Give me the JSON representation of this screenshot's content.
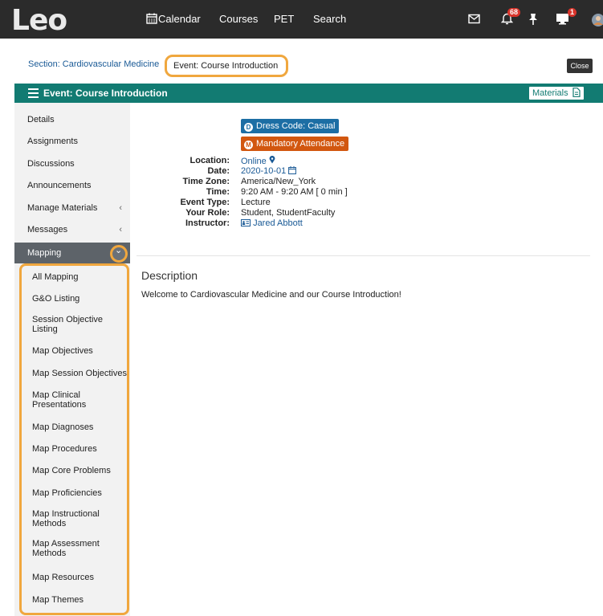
{
  "app": {
    "logo": "Leo",
    "nav": [
      "Calendar",
      "Courses",
      "PET",
      "Search"
    ],
    "notification_count": "68",
    "monitor_count": "1"
  },
  "breadcrumb": {
    "section": "Section: Cardiovascular Medicine",
    "current": "Event: Course Introduction",
    "close": "Close"
  },
  "titlebar": {
    "title": "Event: Course Introduction",
    "materials": "Materials"
  },
  "sidebar": {
    "items": [
      "Details",
      "Assignments",
      "Discussions",
      "Announcements",
      "Manage Materials",
      "Messages",
      "Mapping"
    ],
    "submenu": [
      "All Mapping",
      "G&O Listing",
      "Session Objective Listing",
      "Map Objectives",
      "Map Session Objectives",
      "Map Clinical Presentations",
      "Map Diagnoses",
      "Map Procedures",
      "Map Core Problems",
      "Map Proficiencies",
      "Map Instructional Methods",
      "Map Assessment Methods",
      "Map Resources",
      "Map Themes"
    ]
  },
  "event": {
    "tags": [
      {
        "letter": "D",
        "text": "Dress Code: Casual",
        "color": "#1c6ea4"
      },
      {
        "letter": "M",
        "text": "Mandatory Attendance",
        "color": "#d2570f"
      }
    ],
    "fields": [
      {
        "label": "Location:",
        "value": "Online"
      },
      {
        "label": "Date:",
        "value": "2020-10-01"
      },
      {
        "label": "Time Zone:",
        "value": "America/New_York"
      },
      {
        "label": "Time:",
        "value": "9:20 AM - 9:20 AM [ 0 min ]"
      },
      {
        "label": "Event Type:",
        "value": "Lecture"
      },
      {
        "label": "Your Role:",
        "value": "Student, StudentFaculty"
      },
      {
        "label": "Instructor:",
        "value": "Jared Abbott"
      }
    ]
  },
  "description": {
    "heading": "Description",
    "text": "Welcome to Cardiovascular Medicine and our Course Introduction!"
  },
  "colors": {
    "accent": "#127b72",
    "highlight": "#f0a73e",
    "nav_bg": "#2b2b2b"
  }
}
